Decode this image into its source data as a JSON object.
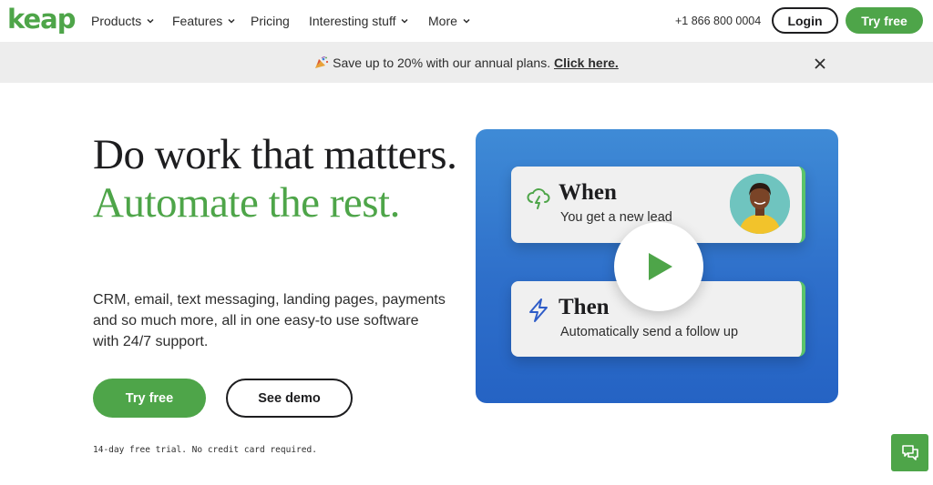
{
  "nav": {
    "logo": "keap",
    "items": [
      {
        "label": "Products",
        "has_dropdown": true
      },
      {
        "label": "Features",
        "has_dropdown": true
      },
      {
        "label": "Pricing",
        "has_dropdown": false
      },
      {
        "label": "Interesting stuff",
        "has_dropdown": true
      },
      {
        "label": "More",
        "has_dropdown": true
      }
    ],
    "phone": "+1 866 800 0004",
    "login_label": "Login",
    "try_free_label": "Try free"
  },
  "banner": {
    "text": "Save up to 20% with our annual plans.",
    "link_label": "Click here.",
    "icon": "party-popper-icon"
  },
  "hero": {
    "headline_dark": "Do work that matters.",
    "headline_green": "Automate the rest.",
    "subtext": "CRM, email, text messaging, landing pages, payments and so much more, all in one easy-to use software with 24/7 support.",
    "try_free_label": "Try free",
    "see_demo_label": "See demo",
    "trial_note": "14-day free trial. No credit card required."
  },
  "video": {
    "when_title": "When",
    "when_sub": "You get a new lead",
    "then_title": "Then",
    "then_sub": "Automatically send a follow up"
  },
  "colors": {
    "brand_green": "#4ea549",
    "panel_blue": "#2e6fca",
    "banner_gray": "#ededed"
  }
}
